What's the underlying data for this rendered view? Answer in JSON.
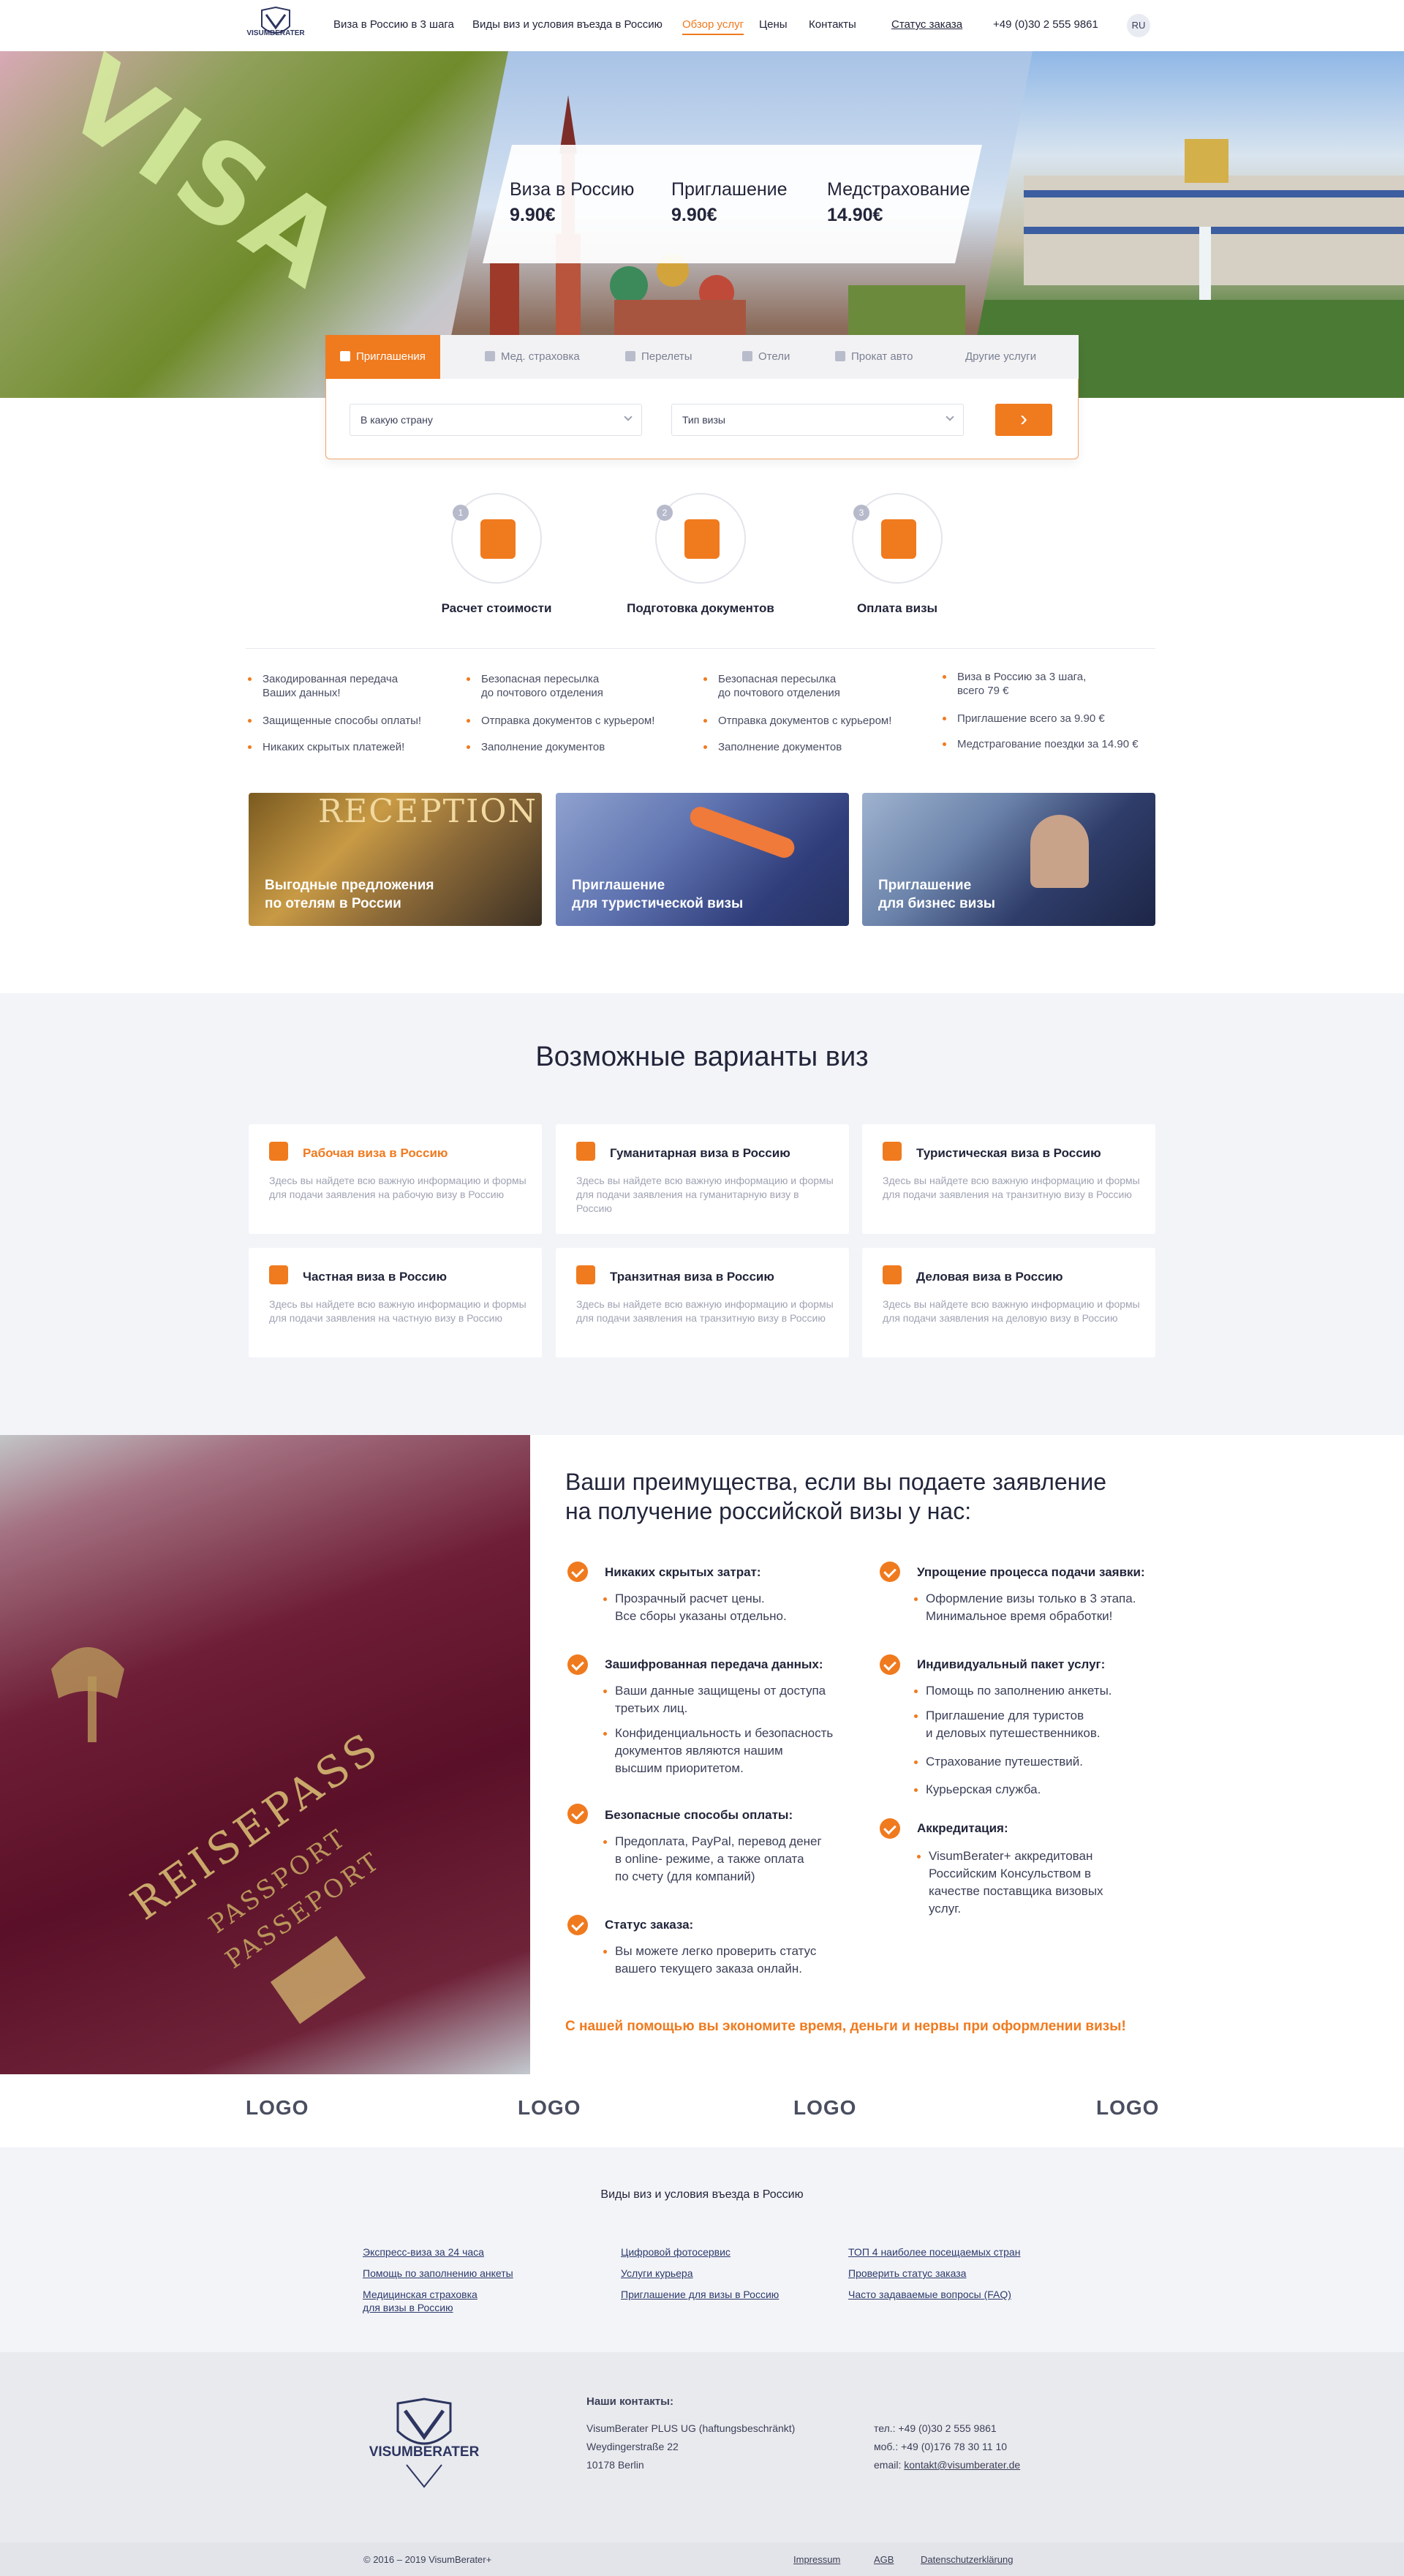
{
  "header": {
    "logo_text": "VISUMBERATER",
    "nav": [
      {
        "label": "Виза в Россию в 3 шага"
      },
      {
        "label": "Виды виз и условия въезда в Россию"
      },
      {
        "label": "Обзор услуг"
      },
      {
        "label": "Цены"
      },
      {
        "label": "Контакты"
      },
      {
        "label": "Статус заказа"
      }
    ],
    "phone": "+49 (0)30 2 555 9861",
    "lang": "RU"
  },
  "hero": {
    "visa_stamp_text": "VISA",
    "prices": [
      {
        "title": "Виза в Россию",
        "price": "9.90€"
      },
      {
        "title": "Приглашение",
        "price": "9.90€"
      },
      {
        "title": "Медстрахование",
        "price": "14.90€"
      }
    ]
  },
  "search": {
    "tabs": [
      "Приглашения",
      "Мед. страховка",
      "Перелеты",
      "Отели",
      "Прокат авто",
      "Другие услуги"
    ],
    "country_placeholder": "В какую страну",
    "visa_type_placeholder": "Тип визы",
    "go_label": "›"
  },
  "steps": [
    {
      "num": "1",
      "label": "Расчет стоимости"
    },
    {
      "num": "2",
      "label": "Подготовка документов"
    },
    {
      "num": "3",
      "label": "Оплата визы"
    }
  ],
  "benefits": [
    [
      "Закодированная передача\nВаших данных!",
      "Защищенные способы оплаты!",
      "Никаких скрытых платежей!"
    ],
    [
      "Безопасная пересылка\nдо почтового отделения",
      "Отправка документов с курьером!",
      "Заполнение документов"
    ],
    [
      "Безопасная пересылка\nдо почтового отделения",
      "Отправка документов с курьером!",
      "Заполнение документов"
    ],
    [
      "Виза в Россию за 3 шага,\nвсего 79 €",
      "Приглашение всего за 9.90 €",
      "Медстрагование поездки за 14.90 €"
    ]
  ],
  "promos": [
    {
      "label": "Выгодные предложения\nпо отелям в России",
      "sign": "RECEPTION"
    },
    {
      "label": "Приглашение\nдля туристической визы"
    },
    {
      "label": "Приглашение\nдля бизнес визы"
    }
  ],
  "visa_section": {
    "title": "Возможные варианты виз",
    "cards": [
      {
        "title": "Рабочая виза в Россию",
        "desc": "Здесь вы найдете всю важную информацию и формы для подачи заявления на рабочую визу в Россию",
        "active": true
      },
      {
        "title": "Гуманитарная виза в Россию",
        "desc": "Здесь вы найдете всю важную информацию и формы для подачи заявления на гуманитарную визу в Россию"
      },
      {
        "title": "Туристическая виза в Россию",
        "desc": "Здесь вы найдете всю важную информацию и формы для подачи заявления на транзитную визу в Россию"
      },
      {
        "title": "Частная виза в Россию",
        "desc": "Здесь вы найдете всю важную информацию и формы для подачи заявления на частную визу в Россию"
      },
      {
        "title": "Транзитная виза в Россию",
        "desc": "Здесь вы найдете всю важную информацию и формы для подачи заявления на транзитную визу в Россию"
      },
      {
        "title": "Деловая виза в Россию",
        "desc": "Здесь вы найдете всю важную информацию и формы для подачи заявления на деловую визу в Россию"
      }
    ]
  },
  "advantages": {
    "passport_title": "REISEPASS",
    "passport_sub1": "PASSPORT",
    "passport_sub2": "PASSEPORT",
    "title": "Ваши преимущества, если вы подаете заявление\nна получение российской визы у нас:",
    "left": [
      {
        "head": "Никаких скрытых затрат:",
        "items": [
          "Прозрачный расчет цены.\nВсе сборы указаны отдельно."
        ]
      },
      {
        "head": "Зашифрованная передача данных:",
        "items": [
          "Ваши данные защищены от доступа\nтретьих лиц.",
          "Конфиденциальность и безопасность\nдокументов являются нашим\nвысшим приоритетом."
        ]
      },
      {
        "head": "Безопасные способы оплаты:",
        "items": [
          "Предоплата, PayPal, перевод  денег\nв online- режиме, а также оплата\nпо счету (для компаний)"
        ]
      },
      {
        "head": "Статус заказа:",
        "items": [
          "Вы можете легко проверить статус\nвашего текущего заказа онлайн."
        ]
      }
    ],
    "right": [
      {
        "head": "Упрощение процесса подачи заявки:",
        "items": [
          "Оформление визы только в 3 этапа.\nМинимальное время обработки!"
        ]
      },
      {
        "head": "Индивидуальный пакет услуг:",
        "items": [
          "Помощь по заполнению анкеты.",
          "Приглашение для туристов\nи деловых путешественников.",
          "Страхование путешествий.",
          "Курьерская служба."
        ]
      },
      {
        "head": "Аккредитация:",
        "items": [
          "VisumBerater+  аккредитован\nРоссийским Консульством в\nкачестве поставщика визовых\nуслуг."
        ]
      }
    ],
    "cta": "С нашей помощью вы  экономите  время, деньги и нервы при оформлении визы!"
  },
  "logos": [
    "LOGO",
    "LOGO",
    "LOGO",
    "LOGO"
  ],
  "link_footer": {
    "title": "Виды виз и условия въезда в Россию",
    "columns": [
      [
        "Экспресс-виза за 24 часа",
        "Помощь по заполнению анкеты",
        "Медицинская страховка\nдля визы в Россию"
      ],
      [
        "Цифровой фотосервис",
        "Услуги курьера",
        "Приглашение для визы в Россию"
      ],
      [
        "ТОП 4 наиболее посещаемых стран",
        "Проверить статус заказа",
        "Часто задаваемые вопросы (FAQ)"
      ]
    ]
  },
  "contacts": {
    "logo_text": "VISUMBERATER",
    "title": "Наши контакты:",
    "address": [
      "VisumBerater PLUS UG (haftungsbeschränkt)",
      "Weydingerstraße 22",
      "10178 Berlin"
    ],
    "phone": "тел.: +49 (0)30 2 555 9861",
    "mobile": "моб.: +49 (0)176 78 30 11 10",
    "email_label": "email:",
    "email": "kontakt@visumberater.de"
  },
  "bottom": {
    "copyright": "© 2016 – 2019 VisumBerater+",
    "links": [
      "Impressum",
      "AGB",
      "Datenschutzerklärung"
    ]
  },
  "colors": {
    "accent": "#f07a1e",
    "text": "#22253a",
    "section_bg": "#f3f4f8"
  }
}
